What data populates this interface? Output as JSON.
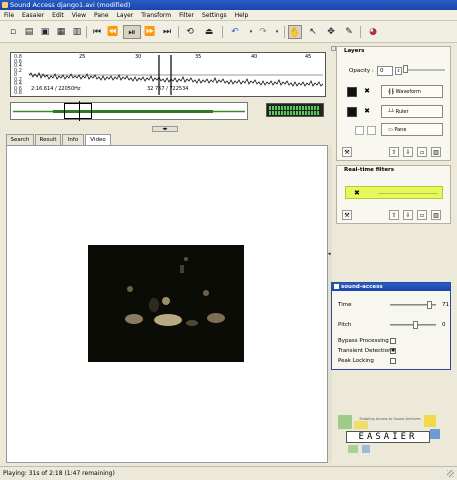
{
  "window": {
    "title": "Sound Access django1.avi (modified)"
  },
  "menu": [
    "File",
    "Easaier",
    "Edit",
    "View",
    "Pane",
    "Layer",
    "Transform",
    "Filter",
    "Settings",
    "Help"
  ],
  "waveform": {
    "scale_labels": [
      "0.8",
      "0.6",
      "0.4",
      "0.2",
      "0",
      "0.2",
      "0.4",
      "0.6",
      "0.8"
    ],
    "ticks": [
      "25",
      "30",
      "35",
      "40",
      "45"
    ],
    "time_readout": "2:16.614 / 22050Hz",
    "sample_readout": "32 767 / 722534"
  },
  "tabs": [
    "Search",
    "Result",
    "Info",
    "Video"
  ],
  "layers": {
    "title": "Layers",
    "opacity_label": "Opacity :",
    "opacity_value": "0",
    "items": [
      {
        "label": "Waveform"
      },
      {
        "label": "Ruler"
      },
      {
        "label": "Pane"
      }
    ]
  },
  "filters": {
    "title": "Real-time filters"
  },
  "sound_access": {
    "title": "sound-access",
    "time_label": "Time",
    "time_value": "71",
    "pitch_label": "Pitch",
    "pitch_value": "0",
    "bypass_label": "Bypass Processing",
    "transient_label": "Transient Detection",
    "peak_label": "Peak Locking",
    "bypass_checked": false,
    "transient_checked": true,
    "peak_checked": false,
    "time_level": 0.88,
    "pitch_level": 0.55
  },
  "logo": {
    "text": "EASAIER",
    "tagline": "Enabling Access to Sound Archives"
  },
  "status": {
    "text": "Playing: 31s of 2:18 (1:47 remaining)"
  }
}
